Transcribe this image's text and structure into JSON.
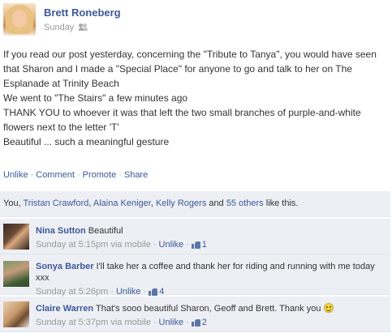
{
  "post": {
    "author": "Brett Roneberg",
    "time": "Sunday",
    "audience_icon": "friends-icon",
    "paragraphs": [
      "If you read our post yesterday, concerning the \"Tribute to Tanya\", you would have seen that Sharon and I made a \"Special Place\" for anyone to go and talk to her on The Esplanade at Trinity Beach",
      "We went to \"The Stairs\" a few minutes ago",
      "THANK YOU to whoever it was that left the two small branches of purple-and-white flowers next to the letter 'T'",
      "Beautiful ... such a meaningful gesture"
    ]
  },
  "actions": {
    "unlike": "Unlike",
    "comment": "Comment",
    "promote": "Promote",
    "share": "Share",
    "separator": "·"
  },
  "likes": {
    "you": "You,",
    "people": [
      "Tristan Crawford",
      "Alaina Keniger",
      "Kelly Rogers"
    ],
    "and": "and",
    "others": "55 others",
    "suffix": "like this."
  },
  "comments": [
    {
      "name": "Nina Sutton",
      "text": "Beautiful",
      "time": "Sunday at 5:15pm via mobile",
      "unlike": "Unlike",
      "likes": "1",
      "has_smiley": false
    },
    {
      "name": "Sonya Barber",
      "text": "I'll take her a coffee and thank her for riding and running with me today xxx",
      "time": "Sunday at 5:26pm",
      "unlike": "Unlike",
      "likes": "4",
      "has_smiley": false
    },
    {
      "name": "Claire Warren",
      "text": "That's sooo beautiful Sharon, Geoff and Brett. Thank you",
      "time": "Sunday at 5:37pm via mobile",
      "unlike": "Unlike",
      "likes": "2",
      "has_smiley": true
    }
  ],
  "colors": {
    "link": "#3b5998",
    "feedback_bg": "#edeff4",
    "meta": "#999999"
  }
}
